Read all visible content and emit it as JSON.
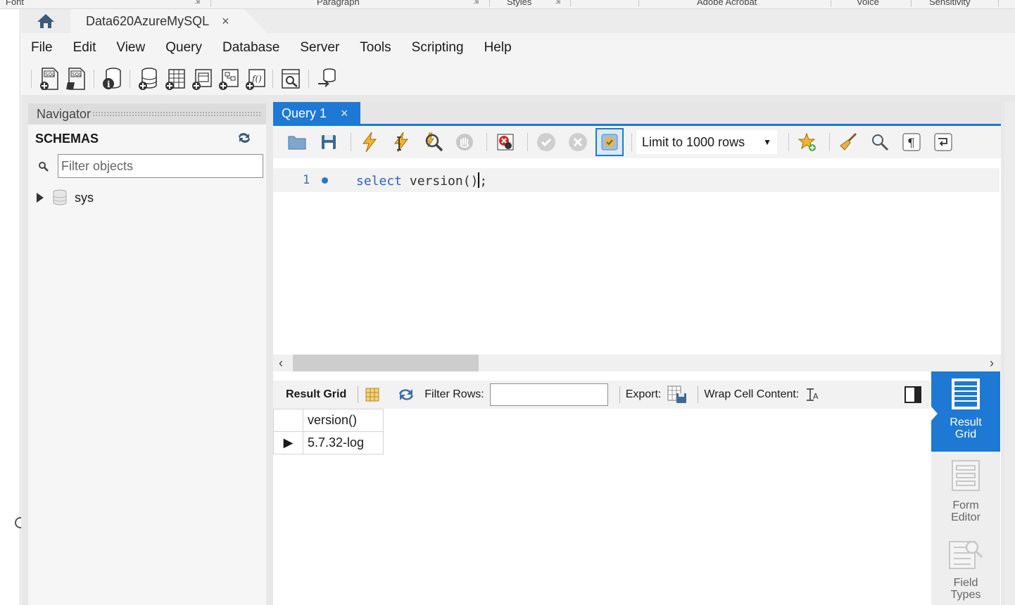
{
  "host": {
    "ribbon_groups": [
      "Font",
      "Paragraph",
      "Styles",
      "Adobe Acrobat",
      "Voice",
      "Sensitivity"
    ]
  },
  "connection_tab": {
    "title": "Data620AzureMySQL",
    "close": "×"
  },
  "menu": [
    "File",
    "Edit",
    "View",
    "Query",
    "Database",
    "Server",
    "Tools",
    "Scripting",
    "Help"
  ],
  "main_toolbar_icons": [
    "new-sql-tab-icon",
    "open-sql-script-icon",
    "schema-inspector-icon",
    "create-schema-icon",
    "create-table-icon",
    "create-view-icon",
    "create-procedure-icon",
    "create-function-icon",
    "search-table-data-icon",
    "reconnect-icon"
  ],
  "navigator": {
    "title": "Navigator",
    "schemas_label": "SCHEMAS",
    "filter_placeholder": "Filter objects",
    "schemas": [
      "sys"
    ]
  },
  "query_tab": {
    "title": "Query 1",
    "close": "×"
  },
  "sql_toolbar": {
    "limit_label": "Limit to 1000 rows"
  },
  "editor": {
    "line_number": "1",
    "keyword": "select",
    "code_before_caret": " version()",
    "code_after_caret": ";"
  },
  "result_toolbar": {
    "result_grid_label": "Result Grid",
    "filter_rows_label": "Filter Rows:",
    "export_label": "Export:",
    "wrap_label": "Wrap Cell Content:"
  },
  "grid": {
    "columns": [
      "version()"
    ],
    "rows": [
      [
        "5.7.32-log"
      ]
    ]
  },
  "side_panel": {
    "result_grid": [
      "Result",
      "Grid"
    ],
    "form_editor": [
      "Form",
      "Editor"
    ],
    "field_types": [
      "Field",
      "Types"
    ]
  },
  "colors": {
    "accent": "#1e79d4",
    "keyword": "#2b64c5"
  }
}
